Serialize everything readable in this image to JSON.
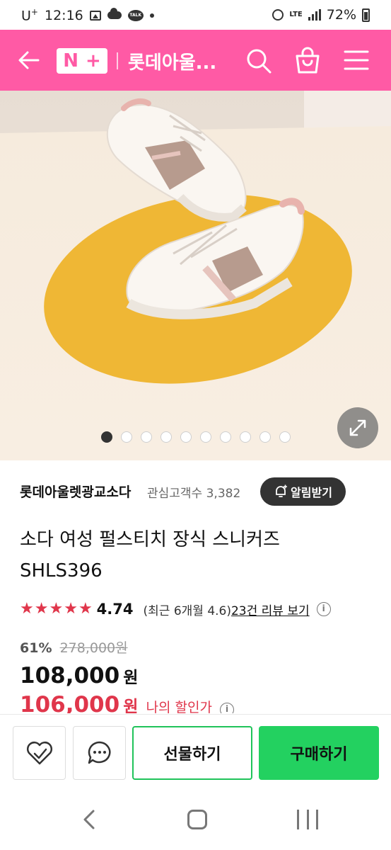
{
  "status_bar": {
    "carrier": "U",
    "carrier_sup": "+",
    "time": "12:16",
    "talk_label": "TALK",
    "lte": "LTE",
    "battery": "72%"
  },
  "header": {
    "logo_n": "N",
    "logo_plus": "+",
    "title": "롯데아울..."
  },
  "carousel": {
    "total": 10,
    "active_index": 0
  },
  "product": {
    "store_name": "롯데아울렛광교소다",
    "fans_label": "관심고객수 3,382",
    "alarm_label": "알림받기",
    "title_line1": "소다 여성 펄스티치 장식 스니커즈",
    "title_line2": "SHLS396",
    "rating_stars": 4.74,
    "rating_score": "4.74",
    "rating_note": "(최근 6개월 4.6)",
    "review_link": "23건 리뷰 보기",
    "info_symbol": "i",
    "discount_rate": "61%",
    "original_price": "278,000원",
    "sale_price": "108,000",
    "won": "원",
    "my_price": "106,000",
    "my_discount_label": "나의 할인가"
  },
  "actions": {
    "gift_label": "선물하기",
    "buy_label": "구매하기"
  },
  "colors": {
    "brand_pink": "#ff5aa5",
    "accent_red": "#e0364b",
    "buy_green": "#23d160"
  }
}
